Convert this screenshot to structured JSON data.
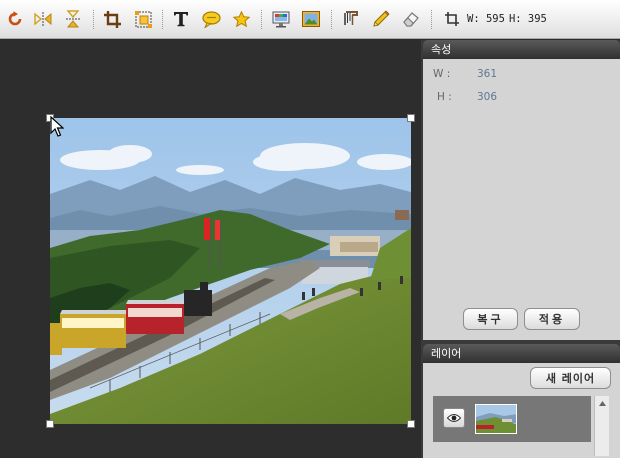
{
  "toolbar": {
    "tools": [
      {
        "name": "rotate-icon",
        "color": "#c84f12"
      },
      {
        "name": "flip-horizontal-icon",
        "color": "#d2a01e"
      },
      {
        "name": "flip-vertical-icon",
        "color": "#d2a01e"
      },
      {
        "name": "crop-icon",
        "color": "#6b3d12"
      },
      {
        "name": "resize-icon",
        "color": "#e8a010"
      },
      {
        "name": "text-icon",
        "color": "#222222"
      },
      {
        "name": "speech-bubble-icon",
        "color": "#f2c40c"
      },
      {
        "name": "star-icon",
        "color": "#f2c40c"
      },
      {
        "name": "monitor-icon",
        "color": "#2a6fd2"
      },
      {
        "name": "image-icon",
        "color": "#e8a010"
      },
      {
        "name": "brush-icon",
        "color": "#7a5632"
      },
      {
        "name": "pencil-icon",
        "color": "#e8b010"
      },
      {
        "name": "eraser-icon",
        "color": "#8a8a8a"
      }
    ],
    "size_readout": {
      "width_text": "W: 595",
      "height_text": "H: 395"
    }
  },
  "properties": {
    "title": "속성",
    "width_label": "W :",
    "width_value": "361",
    "height_label": "H :",
    "height_value": "306",
    "restore_button": "복구",
    "apply_button": "적용"
  },
  "layers": {
    "title": "레이어",
    "new_layer_button": "새 레이어"
  }
}
